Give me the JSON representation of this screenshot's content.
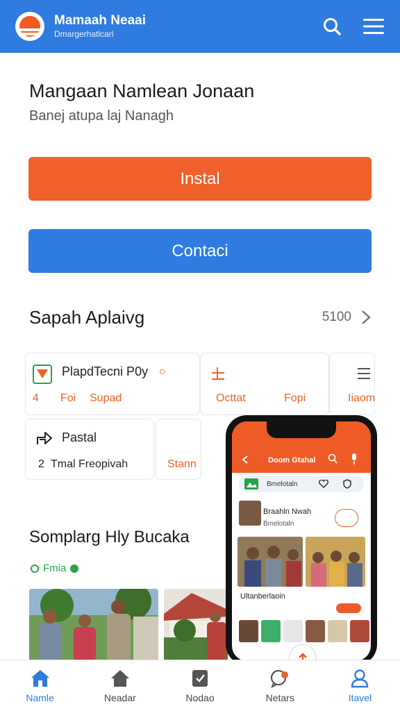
{
  "header": {
    "app_name": "Mamaah Neaai",
    "app_subtitle": "Dmargerhatlcarl",
    "icons": [
      "search-icon",
      "menu-icon"
    ]
  },
  "intro": {
    "title": "Mangaan Namlean Jonaan",
    "subtitle": "Banej atupa laj Nanagh"
  },
  "buttons": {
    "install": "Instal",
    "contact": "Contaci"
  },
  "section": {
    "title": "Sapah Aplaivg",
    "count": "5100"
  },
  "cards": [
    {
      "title": "PlapdTecni P0y",
      "count": "4",
      "tag": "Foi",
      "action": "Supad"
    },
    {
      "label": "Octtat"
    },
    {
      "label": "Fopi"
    },
    {
      "label": "Iiaom"
    },
    {
      "title": "Pastal",
      "count": "2",
      "desc": "Tmal Freopivah"
    },
    {
      "label": "Stann"
    }
  ],
  "section2": {
    "title": "Somplarg Hly Bucaka",
    "filter": "Fmia"
  },
  "phone": {
    "header_title": "Doom Gtahal",
    "search_text": "Bmelotaln",
    "item_name": "Braahln Nwah",
    "item_sub": "Bmelotaln",
    "section": "Ultanberlaoin"
  },
  "nav": [
    {
      "label": "Namle",
      "icon": "home-icon"
    },
    {
      "label": "Neadar",
      "icon": "house-icon"
    },
    {
      "label": "Nodao",
      "icon": "document-icon"
    },
    {
      "label": "Netars",
      "icon": "chat-icon"
    },
    {
      "label": "Itavel",
      "icon": "user-icon"
    }
  ],
  "colors": {
    "primary": "#2f7be0",
    "accent": "#f0602a",
    "success": "#2aa34a"
  }
}
